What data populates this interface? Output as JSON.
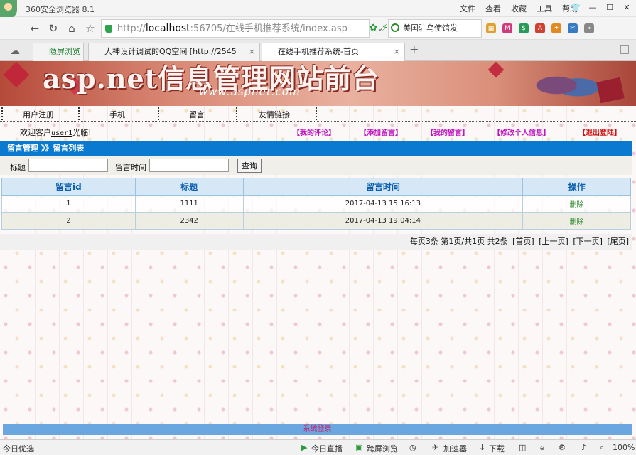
{
  "browser": {
    "app_title": "360安全浏览器 8.1",
    "menu": [
      "文件",
      "查看",
      "收藏",
      "工具",
      "帮助"
    ],
    "url_host": "localhost",
    "url_rest": ":56705/在线手机推荐系统/index.asp",
    "url_scheme": "http://",
    "search_text": "美国驻乌使馆发",
    "tabs": [
      {
        "label": "隐屏浏览"
      },
      {
        "label": "大神设计调试的QQ空间 [http://2545"
      },
      {
        "label": "在线手机推荐系统-首页"
      }
    ]
  },
  "banner": {
    "title": "asp.net信息管理网站前台",
    "url": "www.aspnet.com"
  },
  "nav": {
    "items": [
      "用户注册",
      "手机",
      "留言",
      "友情链接"
    ]
  },
  "welcome": {
    "prefix": "欢迎客户",
    "user": "user1",
    "suffix": "光临!"
  },
  "toplinks": {
    "my_comments": "【我的评论】",
    "add_message": "【添加留言】",
    "my_messages": "【我的留言】",
    "edit_profile": "【修改个人信息】",
    "logout": "【退出登陆】"
  },
  "breadcrumb": "留言管理 》》留言列表",
  "filter": {
    "title_label": "标题",
    "title_value": "",
    "time_label": "留言时间",
    "time_value": "",
    "query_button": "查询"
  },
  "table": {
    "headers": [
      "留言id",
      "标题",
      "留言时间",
      "操作"
    ],
    "rows": [
      {
        "id": "1",
        "title": "1111",
        "time": "2017-04-13 15:16:13",
        "action": "删除"
      },
      {
        "id": "2",
        "title": "2342",
        "time": "2017-04-13 19:04:14",
        "action": "删除"
      }
    ]
  },
  "pager": {
    "summary": "每页3条 第1页/共1页 共2条",
    "first": "[首页]",
    "prev": "[上一页]",
    "next": "[下一页]",
    "last": "[尾页]"
  },
  "footer": "系统登录",
  "statusbar": {
    "left": "今日优选",
    "live": "今日直播",
    "cross": "跨屏浏览",
    "accel": "加速器",
    "download": "下载",
    "zoom": "100%"
  },
  "colors": {
    "header_blue": "#0a7ad0",
    "link_purple": "#c010c0",
    "logout_red": "#d01010"
  }
}
